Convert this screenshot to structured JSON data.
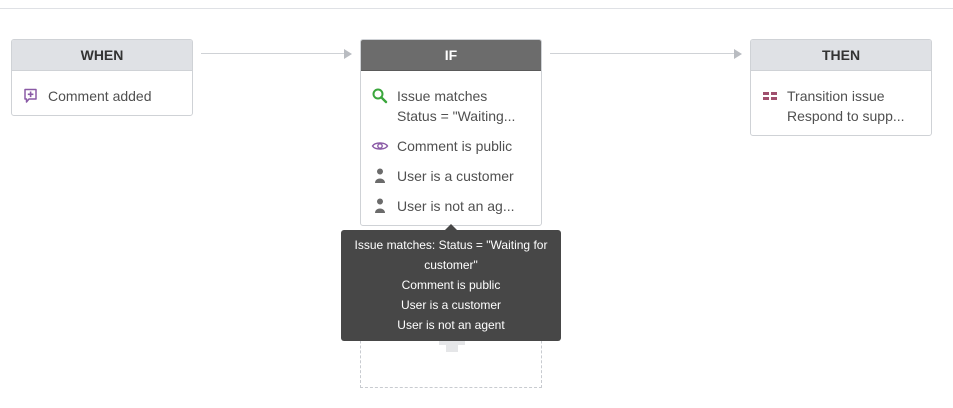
{
  "when": {
    "header": "WHEN",
    "trigger": {
      "label": "Comment added",
      "icon": "comment-add-icon"
    }
  },
  "if": {
    "header": "IF",
    "conditions": [
      {
        "line1": "Issue matches",
        "line2": "Status = \"Waiting...",
        "icon": "search-icon"
      },
      {
        "line1": "Comment is public",
        "icon": "eye-icon"
      },
      {
        "line1": "User is a customer",
        "icon": "user-icon"
      },
      {
        "line1": "User is not an ag...",
        "icon": "user-icon"
      }
    ]
  },
  "then": {
    "header": "THEN",
    "action": {
      "line1": "Transition issue",
      "line2": "Respond to supp...",
      "icon": "transition-icon"
    }
  },
  "tooltip": {
    "lines": [
      "Issue matches: Status = \"Waiting for",
      "customer\"",
      "Comment is public",
      "User is a customer",
      "User is not an agent"
    ]
  },
  "colors": {
    "if_header_bg": "#6c6c6c",
    "header_bg": "#dfe1e5",
    "search_icon": "#3aa63c",
    "purple_icon": "#8a5aa6",
    "tooltip_bg": "#474747"
  }
}
